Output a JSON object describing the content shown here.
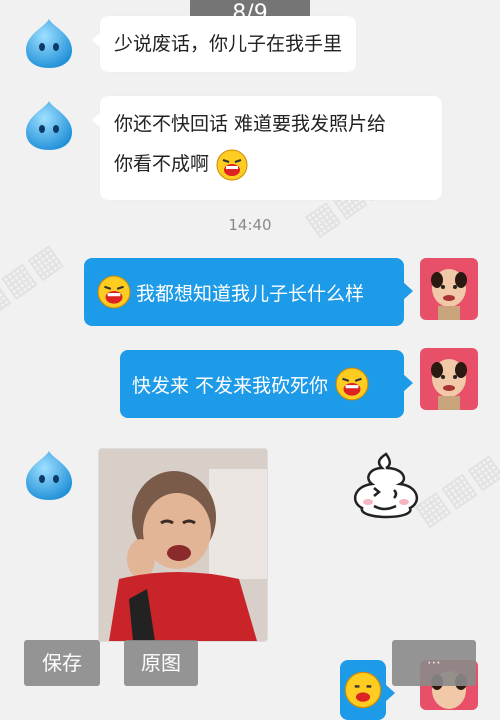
{
  "viewer": {
    "page_indicator": "8/9",
    "save_label": "保存",
    "original_label": "原图"
  },
  "messages": [
    {
      "sender": "contact",
      "text": "少说废话，你儿子在我手里"
    },
    {
      "sender": "contact",
      "line1": "你还不快回话 难道要我发照片给",
      "line2": "你看不成啊"
    },
    {
      "sender": "me",
      "text": "我都想知道我儿子长什么样"
    },
    {
      "sender": "me",
      "text": "快发来 不发来我砍死你"
    }
  ],
  "timestamp": "14:40",
  "icons": [
    "blue-drop-avatar-icon",
    "crying-emoji-icon",
    "user-avatar-photo",
    "poop-sticker-icon",
    "crying-child-photo"
  ],
  "colors": {
    "outgoing_bubble": "#1d9be8",
    "incoming_bubble": "#ffffff",
    "background": "#f1f1f1",
    "avatar_bg": "#e8506a"
  }
}
